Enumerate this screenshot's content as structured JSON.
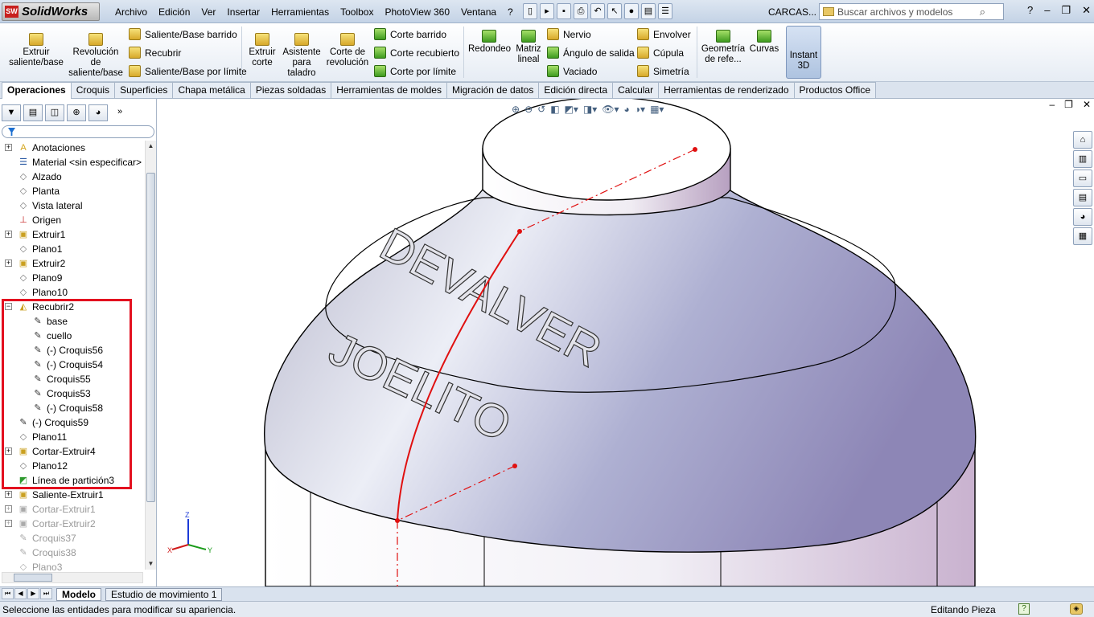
{
  "app": {
    "logo_mark": "SW",
    "logo_text": "SolidWorks",
    "doc_name": "CARCAS..."
  },
  "menu": [
    "Archivo",
    "Edición",
    "Ver",
    "Insertar",
    "Herramientas",
    "Toolbox",
    "PhotoView 360",
    "Ventana",
    "?"
  ],
  "search": {
    "placeholder": "Buscar archivos y modelos"
  },
  "ribbon": {
    "extruir": "Extruir saliente/base",
    "revolucion": "Revolución de saliente/base",
    "barrido": "Saliente/Base barrido",
    "recubrir": "Recubrir",
    "limite": "Saliente/Base por límite",
    "extruir_corte": "Extruir corte",
    "asistente": "Asistente para taladro",
    "corte_rev": "Corte de revolución",
    "corte_barrido": "Corte barrido",
    "corte_recubierto": "Corte recubierto",
    "corte_limite": "Corte por límite",
    "redondeo": "Redondeo",
    "matriz": "Matriz lineal",
    "nervio": "Nervio",
    "angulo": "Ángulo de salida",
    "vaciado": "Vaciado",
    "envolver": "Envolver",
    "cupula": "Cúpula",
    "simetria": "Simetría",
    "geometria": "Geometría de refe...",
    "curvas": "Curvas",
    "instant3d": "Instant 3D"
  },
  "tabs": [
    "Operaciones",
    "Croquis",
    "Superficies",
    "Chapa metálica",
    "Piezas soldadas",
    "Herramientas de moldes",
    "Migración de datos",
    "Edición directa",
    "Calcular",
    "Herramientas de renderizado",
    "Productos Office"
  ],
  "tree": [
    {
      "label": "Anotaciones",
      "icon": "annotation-icon"
    },
    {
      "label": "Material <sin especificar>",
      "icon": "material-icon"
    },
    {
      "label": "Alzado",
      "icon": "plane-icon"
    },
    {
      "label": "Planta",
      "icon": "plane-icon"
    },
    {
      "label": "Vista lateral",
      "icon": "plane-icon"
    },
    {
      "label": "Origen",
      "icon": "origin-icon"
    },
    {
      "label": "Extruir1",
      "icon": "extrude-icon"
    },
    {
      "label": "Plano1",
      "icon": "plane-icon"
    },
    {
      "label": "Extruir2",
      "icon": "extrude-icon"
    },
    {
      "label": "Plano9",
      "icon": "plane-icon"
    },
    {
      "label": "Plano10",
      "icon": "plane-icon"
    },
    {
      "label": "Recubrir2",
      "icon": "loft-icon"
    },
    {
      "label": "base",
      "icon": "sketch-icon"
    },
    {
      "label": "cuello",
      "icon": "sketch-icon"
    },
    {
      "label": "(-) Croquis56",
      "icon": "sketch-icon"
    },
    {
      "label": "(-) Croquis54",
      "icon": "sketch-icon"
    },
    {
      "label": "Croquis55",
      "icon": "sketch-icon"
    },
    {
      "label": "Croquis53",
      "icon": "sketch-icon"
    },
    {
      "label": "(-) Croquis58",
      "icon": "sketch-icon"
    },
    {
      "label": "(-) Croquis59",
      "icon": "sketch-icon"
    },
    {
      "label": "Plano11",
      "icon": "plane-icon"
    },
    {
      "label": "Cortar-Extruir4",
      "icon": "cut-extrude-icon"
    },
    {
      "label": "Plano12",
      "icon": "plane-icon"
    },
    {
      "label": "Línea de partición3",
      "icon": "split-line-icon"
    },
    {
      "label": "Saliente-Extruir1",
      "icon": "extrude-icon"
    },
    {
      "label": "Cortar-Extruir1",
      "icon": "cut-extrude-icon"
    },
    {
      "label": "Cortar-Extruir2",
      "icon": "cut-extrude-icon"
    },
    {
      "label": "Croquis37",
      "icon": "sketch-icon"
    },
    {
      "label": "Croquis38",
      "icon": "sketch-icon"
    },
    {
      "label": "Plano3",
      "icon": "plane-icon"
    }
  ],
  "model": {
    "text_top": "DEVALVER",
    "text_bottom": "JOELITO"
  },
  "triad": {
    "x": "X",
    "y": "Y",
    "z": "Z"
  },
  "bottom_tabs": {
    "model": "Modelo",
    "motion": "Estudio de movimiento 1"
  },
  "status": {
    "message": "Seleccione las entidades para modificar su apariencia.",
    "mode": "Editando Pieza"
  }
}
